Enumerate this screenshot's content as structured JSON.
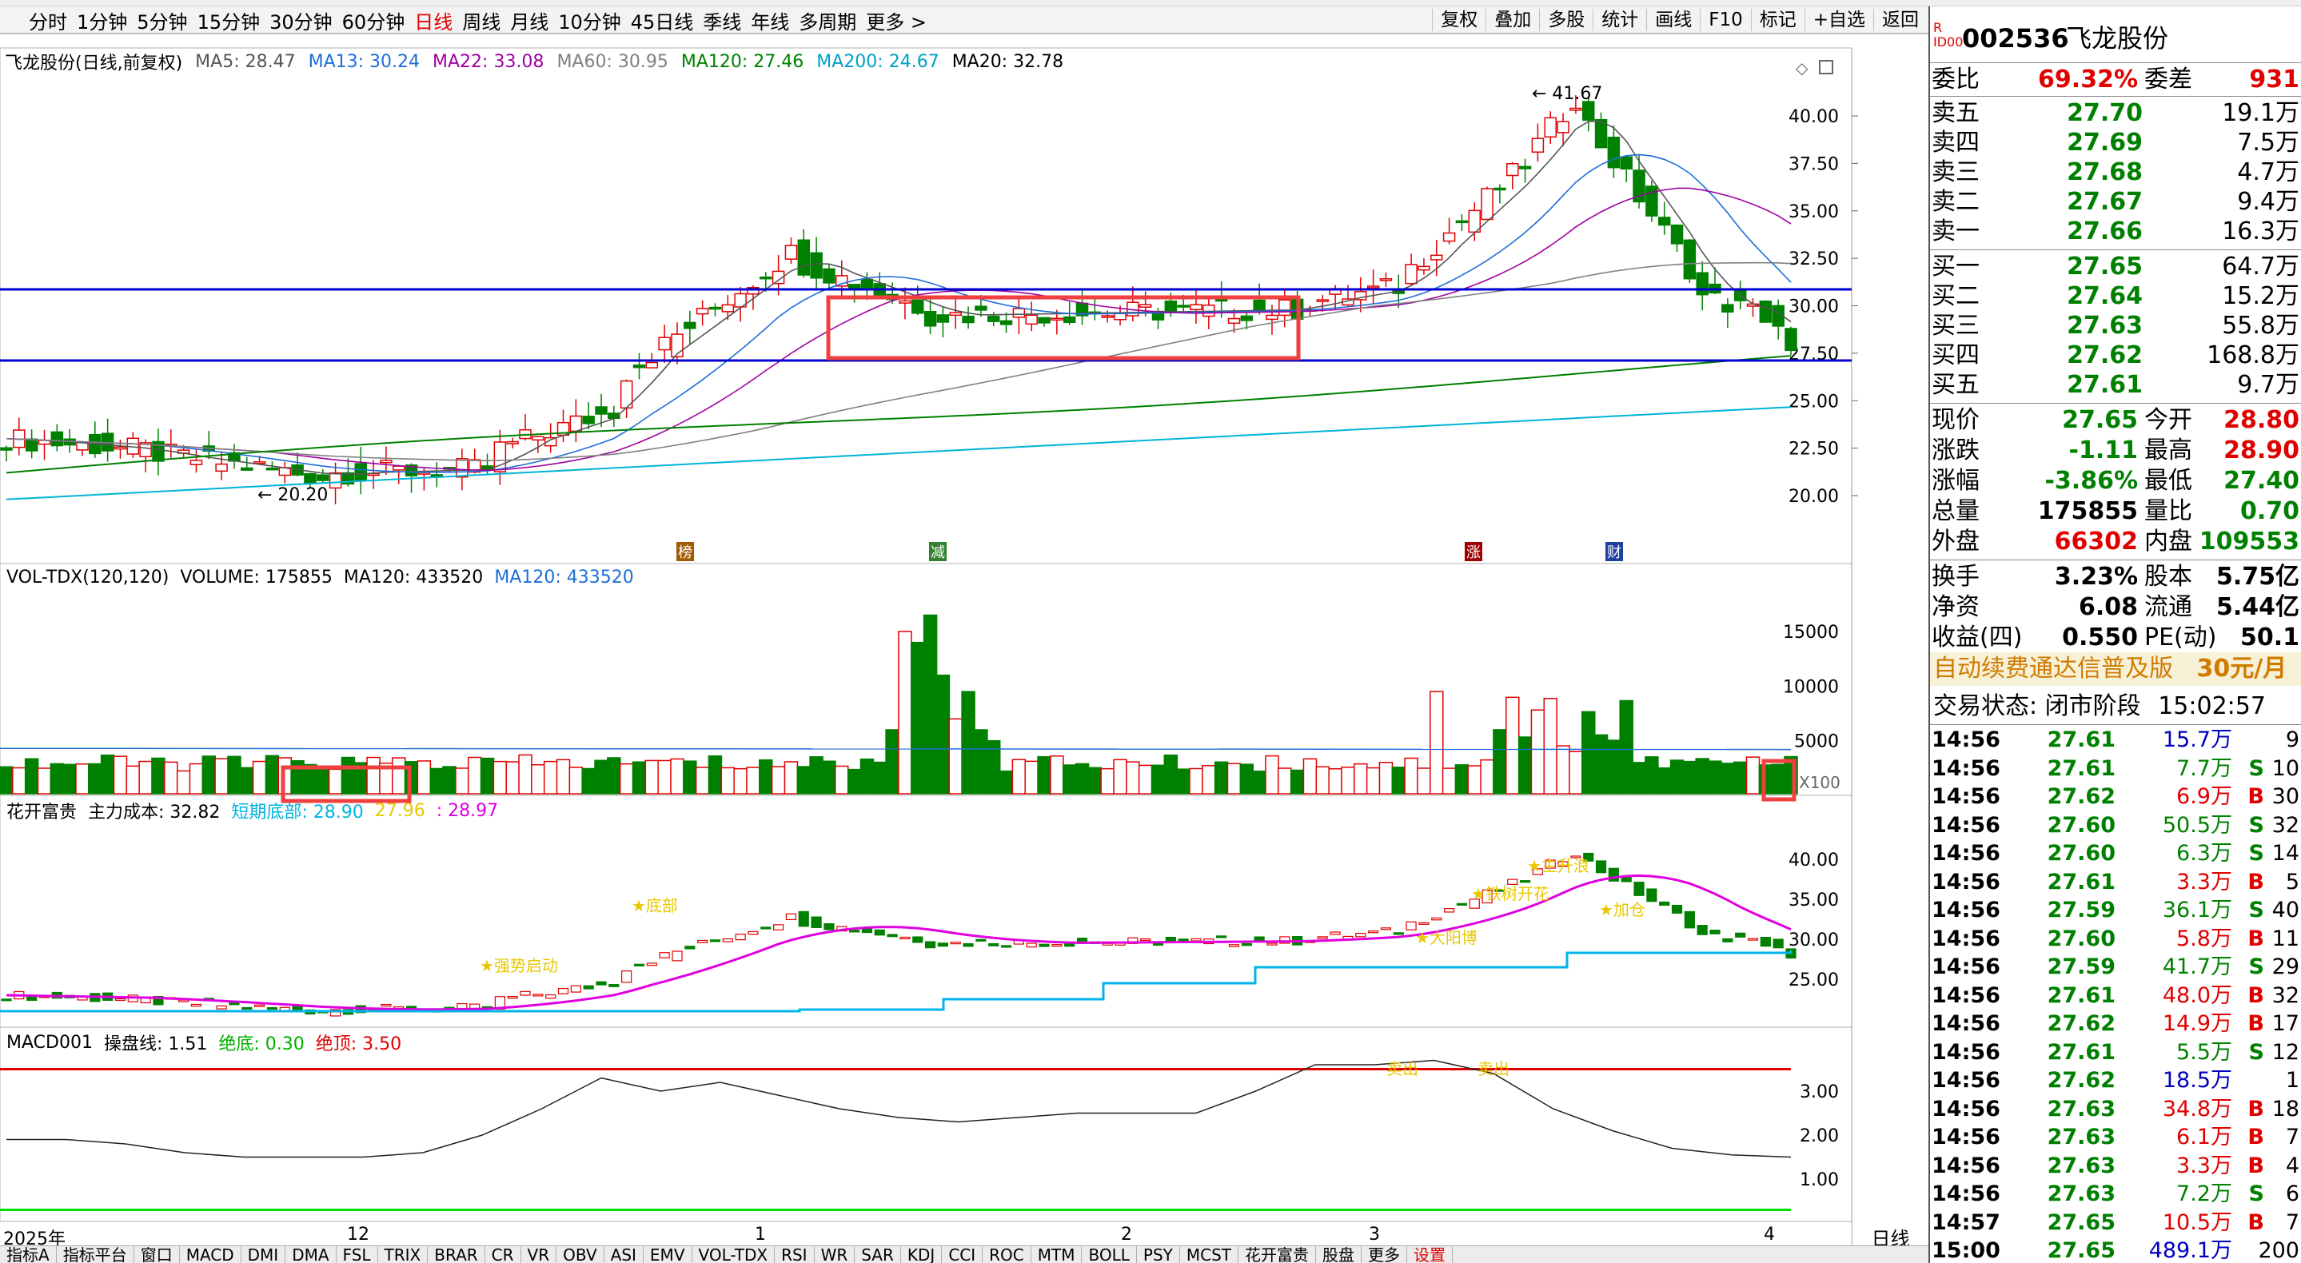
{
  "periods": [
    "分时",
    "1分钟",
    "5分钟",
    "15分钟",
    "30分钟",
    "60分钟",
    "日线",
    "周线",
    "月线",
    "10分钟",
    "45日线",
    "季线",
    "年线",
    "多周期",
    "更多 >"
  ],
  "active_period": "日线",
  "toolbuttons": [
    "复权",
    "叠加",
    "多股",
    "统计",
    "画线",
    "F10",
    "标记",
    "+自选",
    "返回"
  ],
  "main": {
    "title": "飞龙股份(日线,前复权)",
    "ma": [
      {
        "label": "MA5: 28.47",
        "color": "#555555"
      },
      {
        "label": "MA13: 30.24",
        "color": "#1e6ed8"
      },
      {
        "label": "MA22: 33.08",
        "color": "#a000a0"
      },
      {
        "label": "MA60: 30.95",
        "color": "#808080"
      },
      {
        "label": "MA120: 27.46",
        "color": "#008000"
      },
      {
        "label": "MA200: 24.67",
        "color": "#00a0c8"
      },
      {
        "label": "MA20: 32.78",
        "color": "#000000"
      }
    ],
    "high_label": "41.67",
    "low_label": "20.20",
    "price_ticks": [
      "40.00",
      "37.50",
      "35.00",
      "32.50",
      "30.00",
      "27.50",
      "25.00",
      "22.50",
      "20.00"
    ],
    "markers": [
      "榜",
      "减",
      "涨",
      "财"
    ]
  },
  "vol": {
    "title": "VOL-TDX(120,120)",
    "volume": "VOLUME: 175855",
    "ma120a": "MA120: 433520",
    "ma120b": "MA120: 433520",
    "ticks": [
      "15000",
      "10000",
      "5000"
    ],
    "unit": "X100"
  },
  "hk": {
    "title": "花开富贵",
    "cost": "主力成本: 32.82",
    "short_bottom": "短期底部: 28.90",
    "val2": "27.96",
    "val3": ": 28.97",
    "ticks": [
      "40.00",
      "35.00",
      "30.00",
      "25.00"
    ],
    "labels": [
      "强势启动",
      "大阳博",
      "铁树开花",
      "加仓",
      "主升浪",
      "底部"
    ]
  },
  "macd": {
    "title": "MACD001",
    "line": "操盘线: 1.51",
    "bottom": "绝底: 0.30",
    "top": "绝顶: 3.50",
    "ticks": [
      "3.00",
      "2.00",
      "1.00"
    ],
    "labels": [
      "卖出",
      "卖出"
    ]
  },
  "timeaxis": [
    "2025年",
    "12",
    "1",
    "2",
    "3",
    "4"
  ],
  "period_label": "日线",
  "bottom_tabs": [
    "指标A",
    "指标平台",
    "窗口",
    "MACD",
    "DMI",
    "DMA",
    "FSL",
    "TRIX",
    "BRAR",
    "CR",
    "VR",
    "OBV",
    "ASI",
    "EMV",
    "VOL-TDX",
    "RSI",
    "WR",
    "SAR",
    "KDJ",
    "CCI",
    "ROC",
    "MTM",
    "BOLL",
    "PSY",
    "MCST",
    "花开富贵",
    "股盘",
    "更多",
    "设置"
  ],
  "side": {
    "code": "002536",
    "name": "飞龙股份",
    "weibi": {
      "l": "委比",
      "v": "69.32%",
      "l2": "委差",
      "v2": "931"
    },
    "asks": [
      {
        "l": "卖五",
        "p": "27.70",
        "q": "19.1万"
      },
      {
        "l": "卖四",
        "p": "27.69",
        "q": "7.5万"
      },
      {
        "l": "卖三",
        "p": "27.68",
        "q": "4.7万"
      },
      {
        "l": "卖二",
        "p": "27.67",
        "q": "9.4万"
      },
      {
        "l": "卖一",
        "p": "27.66",
        "q": "16.3万"
      }
    ],
    "bids": [
      {
        "l": "买一",
        "p": "27.65",
        "q": "64.7万"
      },
      {
        "l": "买二",
        "p": "27.64",
        "q": "15.2万"
      },
      {
        "l": "买三",
        "p": "27.63",
        "q": "55.8万"
      },
      {
        "l": "买四",
        "p": "27.62",
        "q": "168.8万"
      },
      {
        "l": "买五",
        "p": "27.61",
        "q": "9.7万"
      }
    ],
    "stats": [
      {
        "l": "现价",
        "v": "27.65",
        "vc": "green",
        "l2": "今开",
        "v2": "28.80",
        "v2c": "red"
      },
      {
        "l": "涨跌",
        "v": "-1.11",
        "vc": "green",
        "l2": "最高",
        "v2": "28.90",
        "v2c": "red"
      },
      {
        "l": "涨幅",
        "v": "-3.86%",
        "vc": "green",
        "l2": "最低",
        "v2": "27.40",
        "v2c": "green"
      },
      {
        "l": "总量",
        "v": "175855",
        "vc": "black",
        "l2": "量比",
        "v2": "0.70",
        "v2c": "green"
      },
      {
        "l": "外盘",
        "v": "66302",
        "vc": "red",
        "l2": "内盘",
        "v2": "109553",
        "v2c": "green"
      }
    ],
    "stats2": [
      {
        "l": "换手",
        "v": "3.23%",
        "l2": "股本",
        "v2": "5.75亿"
      },
      {
        "l": "净资",
        "v": "6.08",
        "l2": "流通",
        "v2": "5.44亿"
      },
      {
        "l": "收益(四)",
        "v": "0.550",
        "l2": "PE(动)",
        "v2": "50.1"
      }
    ],
    "promo": "自动续费通达信普及版",
    "promo_price": "30元/月",
    "trade_state": "交易状态: 闭市阶段",
    "trade_time": "15:02:57",
    "ticks": [
      {
        "t": "14:56",
        "p": "27.61",
        "q": "15.7万",
        "s": "",
        "n": "9"
      },
      {
        "t": "14:56",
        "p": "27.61",
        "q": "7.7万",
        "s": "S",
        "n": "10"
      },
      {
        "t": "14:56",
        "p": "27.62",
        "q": "6.9万",
        "s": "B",
        "n": "30"
      },
      {
        "t": "14:56",
        "p": "27.60",
        "q": "50.5万",
        "s": "S",
        "n": "32"
      },
      {
        "t": "14:56",
        "p": "27.60",
        "q": "6.3万",
        "s": "S",
        "n": "14"
      },
      {
        "t": "14:56",
        "p": "27.61",
        "q": "3.3万",
        "s": "B",
        "n": "5"
      },
      {
        "t": "14:56",
        "p": "27.59",
        "q": "36.1万",
        "s": "S",
        "n": "40"
      },
      {
        "t": "14:56",
        "p": "27.60",
        "q": "5.8万",
        "s": "B",
        "n": "11"
      },
      {
        "t": "14:56",
        "p": "27.59",
        "q": "41.7万",
        "s": "S",
        "n": "29"
      },
      {
        "t": "14:56",
        "p": "27.61",
        "q": "48.0万",
        "s": "B",
        "n": "32"
      },
      {
        "t": "14:56",
        "p": "27.62",
        "q": "14.9万",
        "s": "B",
        "n": "17"
      },
      {
        "t": "14:56",
        "p": "27.61",
        "q": "5.5万",
        "s": "S",
        "n": "12"
      },
      {
        "t": "14:56",
        "p": "27.62",
        "q": "18.5万",
        "s": "",
        "n": "1"
      },
      {
        "t": "14:56",
        "p": "27.63",
        "q": "34.8万",
        "s": "B",
        "n": "18"
      },
      {
        "t": "14:56",
        "p": "27.63",
        "q": "6.1万",
        "s": "B",
        "n": "7"
      },
      {
        "t": "14:56",
        "p": "27.63",
        "q": "3.3万",
        "s": "B",
        "n": "4"
      },
      {
        "t": "14:56",
        "p": "27.63",
        "q": "7.2万",
        "s": "S",
        "n": "6"
      },
      {
        "t": "14:57",
        "p": "27.65",
        "q": "10.5万",
        "s": "B",
        "n": "7"
      },
      {
        "t": "15:00",
        "p": "27.65",
        "q": "489.1万",
        "s": "",
        "n": "200"
      }
    ]
  }
}
